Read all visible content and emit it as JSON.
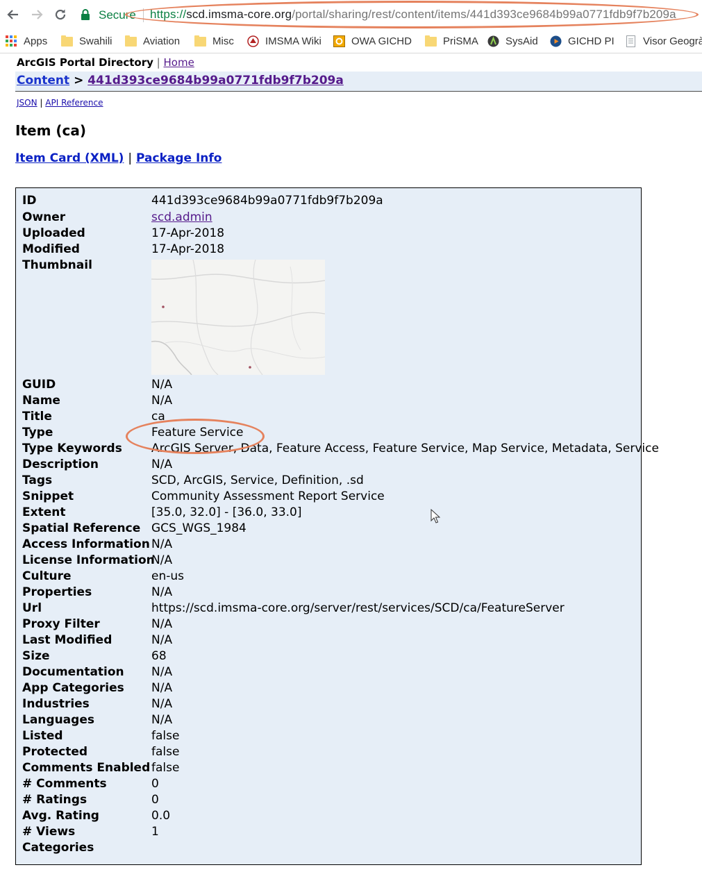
{
  "browser": {
    "secure_label": "Secure",
    "url_scheme": "https://",
    "url_host": "scd.imsma-core.org",
    "url_path": "/portal/sharing/rest/content/items/441d393ce9684b99a0771fdb9f7b209a",
    "bookmarks": [
      {
        "label": "Apps",
        "icon": "apps-grid-icon"
      },
      {
        "label": "Swahili",
        "icon": "folder-icon"
      },
      {
        "label": "Aviation",
        "icon": "folder-icon"
      },
      {
        "label": "Misc",
        "icon": "folder-icon"
      },
      {
        "label": "IMSMA Wiki",
        "icon": "imsma-icon"
      },
      {
        "label": "OWA GICHD",
        "icon": "owa-icon"
      },
      {
        "label": "PriSMA",
        "icon": "folder-icon"
      },
      {
        "label": "SysAid",
        "icon": "sysaid-icon"
      },
      {
        "label": "GICHD PI",
        "icon": "play-icon"
      },
      {
        "label": "Visor Geogrà",
        "icon": "page-icon"
      }
    ],
    "accent_color": "#e5825d"
  },
  "header": {
    "brand": "ArcGIS Portal Directory",
    "separator": "|",
    "home_link": "Home"
  },
  "breadcrumb": {
    "content_link": "Content",
    "arrow": ">",
    "item_link": "441d393ce9684b99a0771fdb9f7b209a"
  },
  "links": {
    "json": "JSON",
    "separator": "|",
    "api_reference": "API Reference",
    "item_card": "Item Card (XML)",
    "package_info": "Package Info"
  },
  "item_title": "Item (ca)",
  "properties": [
    {
      "key": "ID",
      "value": "441d393ce9684b99a0771fdb9f7b209a"
    },
    {
      "key": "Owner",
      "value": "scd.admin",
      "link": true
    },
    {
      "key": "Uploaded",
      "value": "17-Apr-2018"
    },
    {
      "key": "Modified",
      "value": "17-Apr-2018"
    },
    {
      "key": "Thumbnail",
      "value": ""
    },
    {
      "key": "GUID",
      "value": "N/A"
    },
    {
      "key": "Name",
      "value": "N/A"
    },
    {
      "key": "Title",
      "value": "ca"
    },
    {
      "key": "Type",
      "value": "Feature Service"
    },
    {
      "key": "Type Keywords",
      "value": "ArcGIS Server, Data, Feature Access, Feature Service, Map Service, Metadata, Service"
    },
    {
      "key": "Description",
      "value": "N/A"
    },
    {
      "key": "Tags",
      "value": "SCD, ArcGIS, Service, Definition, .sd"
    },
    {
      "key": "Snippet",
      "value": "Community Assessment Report Service"
    },
    {
      "key": "Extent",
      "value": "[35.0, 32.0] - [36.0, 33.0]"
    },
    {
      "key": "Spatial Reference",
      "value": "GCS_WGS_1984"
    },
    {
      "key": "Access Information",
      "value": "N/A"
    },
    {
      "key": "License Information",
      "value": "N/A"
    },
    {
      "key": "Culture",
      "value": "en-us"
    },
    {
      "key": "Properties",
      "value": "N/A"
    },
    {
      "key": "Url",
      "value": "https://scd.imsma-core.org/server/rest/services/SCD/ca/FeatureServer"
    },
    {
      "key": "Proxy Filter",
      "value": "N/A"
    },
    {
      "key": "Last Modified",
      "value": "N/A"
    },
    {
      "key": "Size",
      "value": "68"
    },
    {
      "key": "Documentation",
      "value": "N/A"
    },
    {
      "key": "App Categories",
      "value": "N/A"
    },
    {
      "key": "Industries",
      "value": "N/A"
    },
    {
      "key": "Languages",
      "value": "N/A"
    },
    {
      "key": "Listed",
      "value": "false"
    },
    {
      "key": "Protected",
      "value": "false"
    },
    {
      "key": "Comments Enabled",
      "value": "false"
    },
    {
      "key": "# Comments",
      "value": "0"
    },
    {
      "key": "# Ratings",
      "value": "0"
    },
    {
      "key": "Avg. Rating",
      "value": "0.0"
    },
    {
      "key": "# Views",
      "value": "1"
    },
    {
      "key": "Categories",
      "value": ""
    }
  ]
}
